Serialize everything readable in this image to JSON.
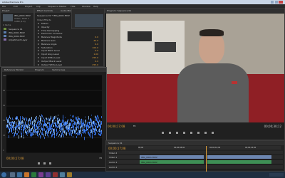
{
  "window": {
    "title": "Adobe Premiere Pro",
    "menus": [
      "File",
      "Edit",
      "Project",
      "Clip",
      "Sequence",
      "Marker",
      "Title",
      "Window",
      "Help"
    ]
  },
  "project_panel": {
    "tabs": [
      "Project",
      "Media Browser",
      "Info"
    ],
    "clip_name": "IMG_0001.MOV",
    "clip_meta": "Video, 1920 x 1080 (1.0)",
    "item_count": "4 Items",
    "items": [
      {
        "name": "Sequence 01"
      },
      {
        "name": "IMG_0001.MOV"
      },
      {
        "name": "IMG_0002.MOV"
      },
      {
        "name": "Adjustment Layer"
      }
    ]
  },
  "effect_controls": {
    "tabs": [
      "Effect Controls",
      "Audio Mixer"
    ],
    "header": "Sequence 01 * IMG_0001.MOV",
    "section": "Video Effects",
    "rows": [
      {
        "label": "Motion",
        "value": ""
      },
      {
        "label": "Opacity",
        "value": ""
      },
      {
        "label": "Time Remapping",
        "value": ""
      },
      {
        "label": "Fast Color Corrector",
        "value": ""
      },
      {
        "label": "Balance Magnitude",
        "value": "0.0"
      },
      {
        "label": "Balance Gain",
        "value": "20.0"
      },
      {
        "label": "Balance Angle",
        "value": "0.0"
      },
      {
        "label": "Saturation",
        "value": "100.0"
      },
      {
        "label": "Input Black Level",
        "value": "0.0"
      },
      {
        "label": "Input Gray Level",
        "value": "1.00"
      },
      {
        "label": "Input White Level",
        "value": "255.0"
      },
      {
        "label": "Output Black Level",
        "value": "0.0"
      },
      {
        "label": "Output White Level",
        "value": "255.0"
      }
    ]
  },
  "scopes": {
    "tabs": [
      "Reference Monitor",
      "Program",
      "Vectorscope"
    ],
    "scale": [
      "100",
      "80",
      "60",
      "40",
      "20",
      "0"
    ],
    "timecode": "00;00;17;08",
    "zoom": "Fit"
  },
  "program_monitor": {
    "tabs": [
      "Program: Sequence 01"
    ],
    "timecode_current": "00;00;17;08",
    "timecode_duration": "00;00;30;12",
    "zoom": "Fit"
  },
  "timeline": {
    "tabs": [
      "Sequence 01"
    ],
    "timecode": "00;00;17;08",
    "ruler": [
      "00;00",
      "00;00;08;00",
      "00;00;16;00",
      "00;00;24;00"
    ],
    "video_clip": "IMG_0001.MOV",
    "audio_clip": "IMG_0001.MOV",
    "track_labels": [
      "Video 2",
      "Video 1",
      "Audio 1",
      "Audio 2"
    ]
  },
  "colors": {
    "accent": "#e2a13a",
    "waveform": "#3a7dff",
    "taskbar": "#1f2e40"
  },
  "waveform_trace": {
    "description_level": "mid-band",
    "band_low_pct": 55,
    "band_high_pct": 75
  }
}
